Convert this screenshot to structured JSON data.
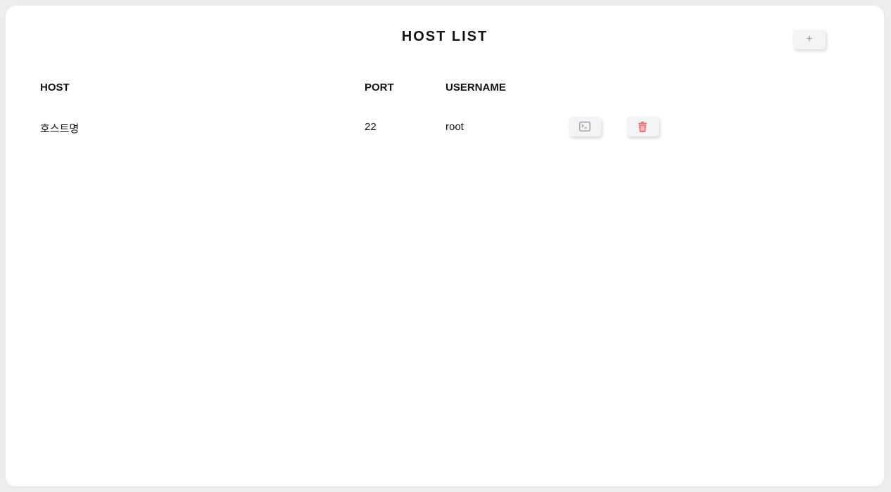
{
  "page": {
    "title": "HOST LIST",
    "add_button_label": "+"
  },
  "table": {
    "columns": [
      "HOST",
      "PORT",
      "USERNAME"
    ],
    "rows": [
      {
        "host": "호스트명",
        "port": "22",
        "username": "root",
        "actions": [
          "terminal-icon",
          "trash-icon"
        ]
      }
    ]
  },
  "colors": {
    "delete_icon": "#ef6b6b",
    "terminal_icon": "#8a8f99",
    "button_bg": "#f4f4f6"
  }
}
